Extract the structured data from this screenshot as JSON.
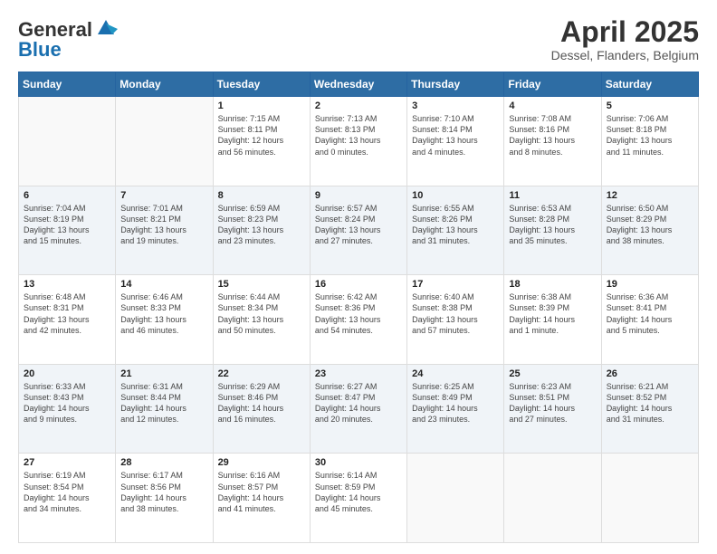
{
  "header": {
    "logo_line1": "General",
    "logo_line2": "Blue",
    "month_title": "April 2025",
    "location": "Dessel, Flanders, Belgium"
  },
  "days_of_week": [
    "Sunday",
    "Monday",
    "Tuesday",
    "Wednesday",
    "Thursday",
    "Friday",
    "Saturday"
  ],
  "weeks": [
    [
      {
        "day": "",
        "info": ""
      },
      {
        "day": "",
        "info": ""
      },
      {
        "day": "1",
        "info": "Sunrise: 7:15 AM\nSunset: 8:11 PM\nDaylight: 12 hours\nand 56 minutes."
      },
      {
        "day": "2",
        "info": "Sunrise: 7:13 AM\nSunset: 8:13 PM\nDaylight: 13 hours\nand 0 minutes."
      },
      {
        "day": "3",
        "info": "Sunrise: 7:10 AM\nSunset: 8:14 PM\nDaylight: 13 hours\nand 4 minutes."
      },
      {
        "day": "4",
        "info": "Sunrise: 7:08 AM\nSunset: 8:16 PM\nDaylight: 13 hours\nand 8 minutes."
      },
      {
        "day": "5",
        "info": "Sunrise: 7:06 AM\nSunset: 8:18 PM\nDaylight: 13 hours\nand 11 minutes."
      }
    ],
    [
      {
        "day": "6",
        "info": "Sunrise: 7:04 AM\nSunset: 8:19 PM\nDaylight: 13 hours\nand 15 minutes."
      },
      {
        "day": "7",
        "info": "Sunrise: 7:01 AM\nSunset: 8:21 PM\nDaylight: 13 hours\nand 19 minutes."
      },
      {
        "day": "8",
        "info": "Sunrise: 6:59 AM\nSunset: 8:23 PM\nDaylight: 13 hours\nand 23 minutes."
      },
      {
        "day": "9",
        "info": "Sunrise: 6:57 AM\nSunset: 8:24 PM\nDaylight: 13 hours\nand 27 minutes."
      },
      {
        "day": "10",
        "info": "Sunrise: 6:55 AM\nSunset: 8:26 PM\nDaylight: 13 hours\nand 31 minutes."
      },
      {
        "day": "11",
        "info": "Sunrise: 6:53 AM\nSunset: 8:28 PM\nDaylight: 13 hours\nand 35 minutes."
      },
      {
        "day": "12",
        "info": "Sunrise: 6:50 AM\nSunset: 8:29 PM\nDaylight: 13 hours\nand 38 minutes."
      }
    ],
    [
      {
        "day": "13",
        "info": "Sunrise: 6:48 AM\nSunset: 8:31 PM\nDaylight: 13 hours\nand 42 minutes."
      },
      {
        "day": "14",
        "info": "Sunrise: 6:46 AM\nSunset: 8:33 PM\nDaylight: 13 hours\nand 46 minutes."
      },
      {
        "day": "15",
        "info": "Sunrise: 6:44 AM\nSunset: 8:34 PM\nDaylight: 13 hours\nand 50 minutes."
      },
      {
        "day": "16",
        "info": "Sunrise: 6:42 AM\nSunset: 8:36 PM\nDaylight: 13 hours\nand 54 minutes."
      },
      {
        "day": "17",
        "info": "Sunrise: 6:40 AM\nSunset: 8:38 PM\nDaylight: 13 hours\nand 57 minutes."
      },
      {
        "day": "18",
        "info": "Sunrise: 6:38 AM\nSunset: 8:39 PM\nDaylight: 14 hours\nand 1 minute."
      },
      {
        "day": "19",
        "info": "Sunrise: 6:36 AM\nSunset: 8:41 PM\nDaylight: 14 hours\nand 5 minutes."
      }
    ],
    [
      {
        "day": "20",
        "info": "Sunrise: 6:33 AM\nSunset: 8:43 PM\nDaylight: 14 hours\nand 9 minutes."
      },
      {
        "day": "21",
        "info": "Sunrise: 6:31 AM\nSunset: 8:44 PM\nDaylight: 14 hours\nand 12 minutes."
      },
      {
        "day": "22",
        "info": "Sunrise: 6:29 AM\nSunset: 8:46 PM\nDaylight: 14 hours\nand 16 minutes."
      },
      {
        "day": "23",
        "info": "Sunrise: 6:27 AM\nSunset: 8:47 PM\nDaylight: 14 hours\nand 20 minutes."
      },
      {
        "day": "24",
        "info": "Sunrise: 6:25 AM\nSunset: 8:49 PM\nDaylight: 14 hours\nand 23 minutes."
      },
      {
        "day": "25",
        "info": "Sunrise: 6:23 AM\nSunset: 8:51 PM\nDaylight: 14 hours\nand 27 minutes."
      },
      {
        "day": "26",
        "info": "Sunrise: 6:21 AM\nSunset: 8:52 PM\nDaylight: 14 hours\nand 31 minutes."
      }
    ],
    [
      {
        "day": "27",
        "info": "Sunrise: 6:19 AM\nSunset: 8:54 PM\nDaylight: 14 hours\nand 34 minutes."
      },
      {
        "day": "28",
        "info": "Sunrise: 6:17 AM\nSunset: 8:56 PM\nDaylight: 14 hours\nand 38 minutes."
      },
      {
        "day": "29",
        "info": "Sunrise: 6:16 AM\nSunset: 8:57 PM\nDaylight: 14 hours\nand 41 minutes."
      },
      {
        "day": "30",
        "info": "Sunrise: 6:14 AM\nSunset: 8:59 PM\nDaylight: 14 hours\nand 45 minutes."
      },
      {
        "day": "",
        "info": ""
      },
      {
        "day": "",
        "info": ""
      },
      {
        "day": "",
        "info": ""
      }
    ]
  ]
}
